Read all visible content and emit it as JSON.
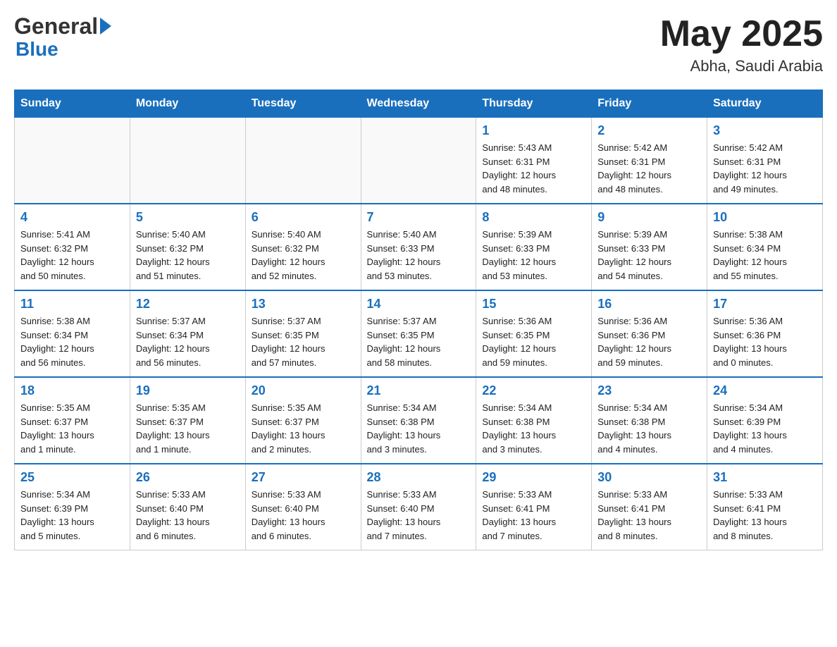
{
  "header": {
    "logo_general": "General",
    "logo_blue": "Blue",
    "month_year": "May 2025",
    "location": "Abha, Saudi Arabia"
  },
  "weekdays": [
    "Sunday",
    "Monday",
    "Tuesday",
    "Wednesday",
    "Thursday",
    "Friday",
    "Saturday"
  ],
  "weeks": [
    [
      {
        "day": "",
        "info": ""
      },
      {
        "day": "",
        "info": ""
      },
      {
        "day": "",
        "info": ""
      },
      {
        "day": "",
        "info": ""
      },
      {
        "day": "1",
        "info": "Sunrise: 5:43 AM\nSunset: 6:31 PM\nDaylight: 12 hours\nand 48 minutes."
      },
      {
        "day": "2",
        "info": "Sunrise: 5:42 AM\nSunset: 6:31 PM\nDaylight: 12 hours\nand 48 minutes."
      },
      {
        "day": "3",
        "info": "Sunrise: 5:42 AM\nSunset: 6:31 PM\nDaylight: 12 hours\nand 49 minutes."
      }
    ],
    [
      {
        "day": "4",
        "info": "Sunrise: 5:41 AM\nSunset: 6:32 PM\nDaylight: 12 hours\nand 50 minutes."
      },
      {
        "day": "5",
        "info": "Sunrise: 5:40 AM\nSunset: 6:32 PM\nDaylight: 12 hours\nand 51 minutes."
      },
      {
        "day": "6",
        "info": "Sunrise: 5:40 AM\nSunset: 6:32 PM\nDaylight: 12 hours\nand 52 minutes."
      },
      {
        "day": "7",
        "info": "Sunrise: 5:40 AM\nSunset: 6:33 PM\nDaylight: 12 hours\nand 53 minutes."
      },
      {
        "day": "8",
        "info": "Sunrise: 5:39 AM\nSunset: 6:33 PM\nDaylight: 12 hours\nand 53 minutes."
      },
      {
        "day": "9",
        "info": "Sunrise: 5:39 AM\nSunset: 6:33 PM\nDaylight: 12 hours\nand 54 minutes."
      },
      {
        "day": "10",
        "info": "Sunrise: 5:38 AM\nSunset: 6:34 PM\nDaylight: 12 hours\nand 55 minutes."
      }
    ],
    [
      {
        "day": "11",
        "info": "Sunrise: 5:38 AM\nSunset: 6:34 PM\nDaylight: 12 hours\nand 56 minutes."
      },
      {
        "day": "12",
        "info": "Sunrise: 5:37 AM\nSunset: 6:34 PM\nDaylight: 12 hours\nand 56 minutes."
      },
      {
        "day": "13",
        "info": "Sunrise: 5:37 AM\nSunset: 6:35 PM\nDaylight: 12 hours\nand 57 minutes."
      },
      {
        "day": "14",
        "info": "Sunrise: 5:37 AM\nSunset: 6:35 PM\nDaylight: 12 hours\nand 58 minutes."
      },
      {
        "day": "15",
        "info": "Sunrise: 5:36 AM\nSunset: 6:35 PM\nDaylight: 12 hours\nand 59 minutes."
      },
      {
        "day": "16",
        "info": "Sunrise: 5:36 AM\nSunset: 6:36 PM\nDaylight: 12 hours\nand 59 minutes."
      },
      {
        "day": "17",
        "info": "Sunrise: 5:36 AM\nSunset: 6:36 PM\nDaylight: 13 hours\nand 0 minutes."
      }
    ],
    [
      {
        "day": "18",
        "info": "Sunrise: 5:35 AM\nSunset: 6:37 PM\nDaylight: 13 hours\nand 1 minute."
      },
      {
        "day": "19",
        "info": "Sunrise: 5:35 AM\nSunset: 6:37 PM\nDaylight: 13 hours\nand 1 minute."
      },
      {
        "day": "20",
        "info": "Sunrise: 5:35 AM\nSunset: 6:37 PM\nDaylight: 13 hours\nand 2 minutes."
      },
      {
        "day": "21",
        "info": "Sunrise: 5:34 AM\nSunset: 6:38 PM\nDaylight: 13 hours\nand 3 minutes."
      },
      {
        "day": "22",
        "info": "Sunrise: 5:34 AM\nSunset: 6:38 PM\nDaylight: 13 hours\nand 3 minutes."
      },
      {
        "day": "23",
        "info": "Sunrise: 5:34 AM\nSunset: 6:38 PM\nDaylight: 13 hours\nand 4 minutes."
      },
      {
        "day": "24",
        "info": "Sunrise: 5:34 AM\nSunset: 6:39 PM\nDaylight: 13 hours\nand 4 minutes."
      }
    ],
    [
      {
        "day": "25",
        "info": "Sunrise: 5:34 AM\nSunset: 6:39 PM\nDaylight: 13 hours\nand 5 minutes."
      },
      {
        "day": "26",
        "info": "Sunrise: 5:33 AM\nSunset: 6:40 PM\nDaylight: 13 hours\nand 6 minutes."
      },
      {
        "day": "27",
        "info": "Sunrise: 5:33 AM\nSunset: 6:40 PM\nDaylight: 13 hours\nand 6 minutes."
      },
      {
        "day": "28",
        "info": "Sunrise: 5:33 AM\nSunset: 6:40 PM\nDaylight: 13 hours\nand 7 minutes."
      },
      {
        "day": "29",
        "info": "Sunrise: 5:33 AM\nSunset: 6:41 PM\nDaylight: 13 hours\nand 7 minutes."
      },
      {
        "day": "30",
        "info": "Sunrise: 5:33 AM\nSunset: 6:41 PM\nDaylight: 13 hours\nand 8 minutes."
      },
      {
        "day": "31",
        "info": "Sunrise: 5:33 AM\nSunset: 6:41 PM\nDaylight: 13 hours\nand 8 minutes."
      }
    ]
  ]
}
